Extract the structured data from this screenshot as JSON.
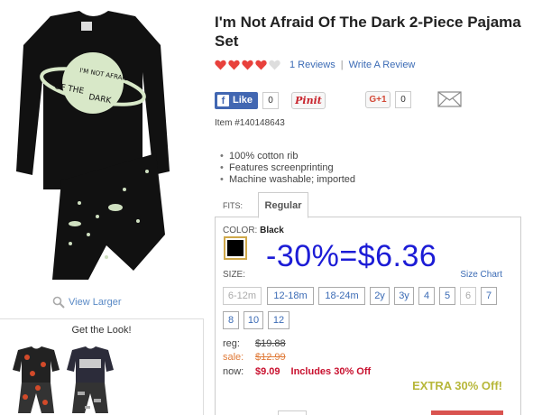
{
  "product": {
    "title": "I'm Not Afraid Of The Dark 2-Piece Pajama Set",
    "item_number": "Item #140148643",
    "features": [
      "100% cotton rib",
      "Features screenprinting",
      "Machine washable; imported"
    ]
  },
  "rating": {
    "hearts_filled": 4,
    "hearts_total": 5,
    "reviews_link": "1 Reviews",
    "separator": "|",
    "write_review": "Write A Review"
  },
  "social": {
    "facebook_label": "Like",
    "facebook_count": "0",
    "pinterest_label": "Pinit",
    "gplus_label": "G+1",
    "gplus_count": "0"
  },
  "gallery": {
    "view_larger": "View Larger",
    "get_the_look": "Get the Look!"
  },
  "fits": {
    "label": "FITS:",
    "selected": "Regular"
  },
  "color": {
    "label": "COLOR:",
    "value": "Black",
    "swatch": "#000000"
  },
  "promo_overlay": "-30%=$6.36",
  "sizes": {
    "label": "SIZE:",
    "chart_link": "Size Chart",
    "options": [
      {
        "label": "6-12m",
        "available": false
      },
      {
        "label": "12-18m",
        "available": true
      },
      {
        "label": "18-24m",
        "available": true
      },
      {
        "label": "2y",
        "available": true
      },
      {
        "label": "3y",
        "available": true
      },
      {
        "label": "4",
        "available": true
      },
      {
        "label": "5",
        "available": true
      },
      {
        "label": "6",
        "available": false
      },
      {
        "label": "7",
        "available": true
      },
      {
        "label": "8",
        "available": true
      },
      {
        "label": "10",
        "available": true
      },
      {
        "label": "12",
        "available": true
      }
    ]
  },
  "pricing": {
    "reg_label": "reg:",
    "reg_price": "$19.88",
    "sale_label": "sale:",
    "sale_price": "$12.99",
    "now_label": "now:",
    "now_price": "$9.09",
    "now_note": "Includes 30% Off",
    "extra": "EXTRA 30% Off!"
  },
  "colors": {
    "link": "#3b6bb5",
    "heart": "#e8413c",
    "sale": "#e07b39",
    "now": "#c8102e",
    "promo": "#1c1cd6"
  }
}
